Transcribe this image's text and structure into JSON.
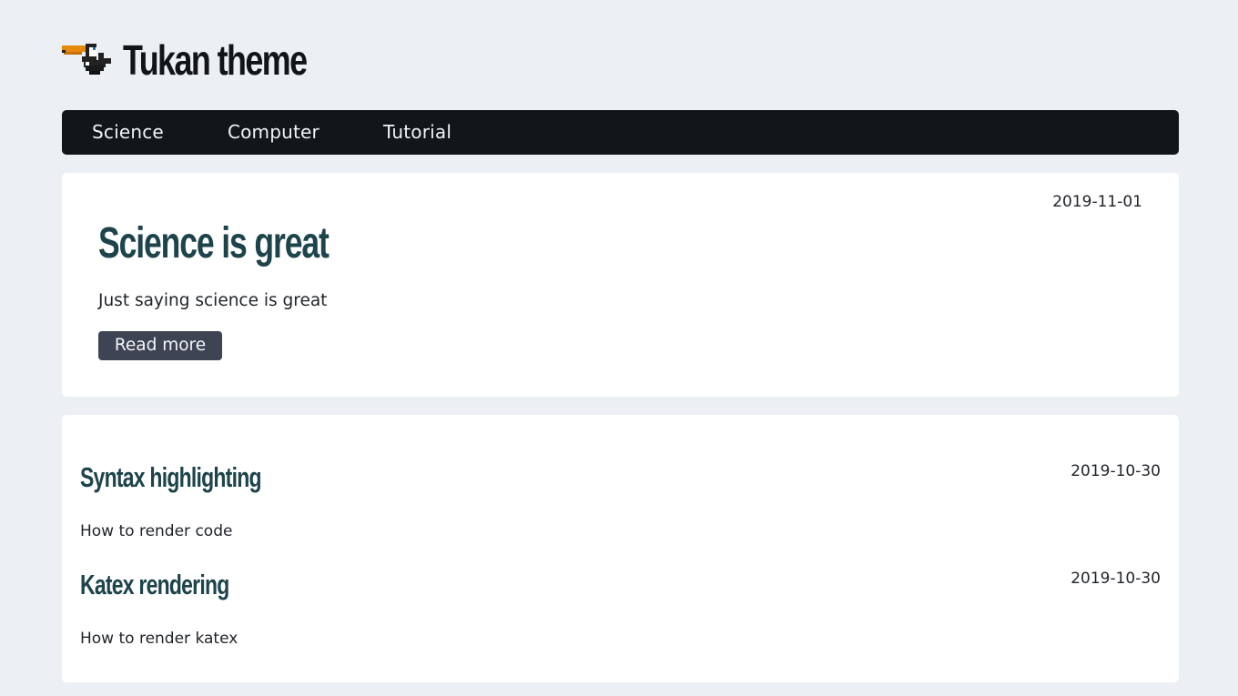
{
  "site": {
    "title": "Tukan theme",
    "logo_icon": "toucan-icon",
    "colors": {
      "background": "#eceff4",
      "nav_background": "#11161b",
      "title_accent": "#1d434b",
      "button": "#3e4454"
    }
  },
  "nav": {
    "items": [
      {
        "label": "Science"
      },
      {
        "label": "Computer"
      },
      {
        "label": "Tutorial"
      }
    ]
  },
  "featured": {
    "date": "2019-11-01",
    "title": "Science is great",
    "summary": "Just saying science is great",
    "button_label": "Read more"
  },
  "posts": [
    {
      "title": "Syntax highlighting",
      "date": "2019-10-30",
      "summary": "How to render code"
    },
    {
      "title": "Katex rendering",
      "date": "2019-10-30",
      "summary": "How to render katex"
    }
  ]
}
